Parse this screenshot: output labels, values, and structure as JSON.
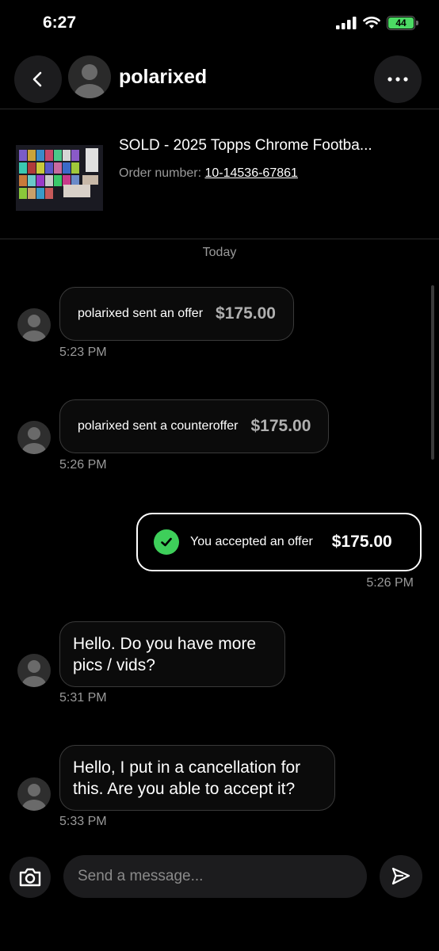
{
  "status_bar": {
    "time": "6:27",
    "battery": "44"
  },
  "header": {
    "name": "polarixed"
  },
  "item": {
    "title": "SOLD - 2025 Topps Chrome Footba...",
    "order_label": "Order number: ",
    "order_number": "10-14536-67861"
  },
  "day_label": "Today",
  "messages": [
    {
      "type": "offer",
      "text": "polarixed sent an offer",
      "price": "$175.00",
      "time": "5:23 PM"
    },
    {
      "type": "offer",
      "text": "polarixed sent a counteroffer",
      "price": "$175.00",
      "time": "5:26 PM"
    },
    {
      "type": "accepted",
      "text": "You accepted an offer",
      "price": "$175.00",
      "time": "5:26 PM"
    },
    {
      "type": "text",
      "text": "Hello. Do you have more pics / vids?",
      "time": "5:31 PM"
    },
    {
      "type": "text",
      "text": "Hello, I put in a cancellation for this. Are you able to accept it?",
      "time": "5:33 PM"
    }
  ],
  "composer": {
    "placeholder": "Send a message..."
  },
  "colors": {
    "accent_green": "#3ecf5a",
    "battery_green": "#4cd964",
    "background": "#000000"
  },
  "icons": [
    "chevron-left-icon",
    "more-icon",
    "camera-icon",
    "send-icon",
    "check-icon",
    "avatar-icon"
  ]
}
